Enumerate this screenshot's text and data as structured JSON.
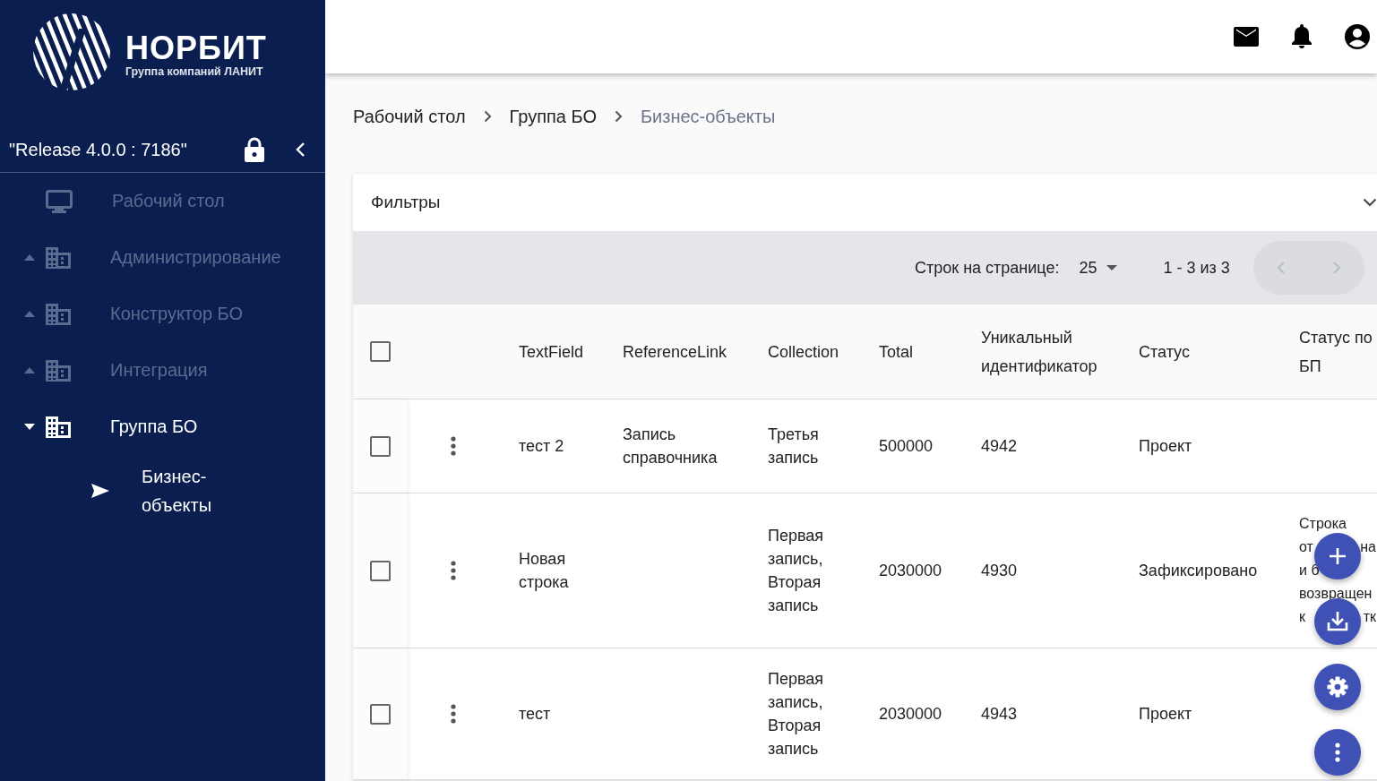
{
  "brand": {
    "name": "НОРБИТ",
    "tagline": "Группа компаний ЛАНИТ"
  },
  "release": "\"Release 4.0.0 : 7186\"",
  "sidebar": {
    "items": [
      {
        "label": "Рабочий стол",
        "kind": "link",
        "selected": false
      },
      {
        "label": "Администрирование",
        "kind": "group",
        "expanded": false,
        "selected": false
      },
      {
        "label": "Конструктор БО",
        "kind": "group",
        "expanded": false,
        "selected": false
      },
      {
        "label": "Интеграция",
        "kind": "group",
        "expanded": false,
        "selected": false
      },
      {
        "label": "Группа БО",
        "kind": "group",
        "expanded": true,
        "selected": true,
        "children": [
          {
            "label": "Бизнес-объекты",
            "selected": true
          }
        ]
      }
    ]
  },
  "breadcrumbs": [
    "Рабочий стол",
    "Группа БО",
    "Бизнес-объекты"
  ],
  "filters": {
    "title": "Фильтры",
    "expanded": false
  },
  "pagination": {
    "rows_label": "Строк на странице:",
    "rows_per_page": "25",
    "range": "1 - 3 из 3",
    "prev_disabled": true,
    "next_disabled": true
  },
  "table": {
    "columns": [
      "TextField",
      "ReferenceLink",
      "Collection",
      "Total",
      "Уникальный идентификатор",
      "Статус",
      "Статус по БП"
    ],
    "all_checked": false,
    "rows": [
      {
        "checked": false,
        "cells": [
          "тест 2",
          "Запись справочника",
          "Третья запись",
          "500000",
          "4942",
          "Проект",
          ""
        ]
      },
      {
        "checked": false,
        "cells": [
          "Новая строка",
          "",
          "Первая запись, Вторая запись",
          "2030000",
          "4930",
          "Зафиксировано",
          [
            [
              "Строка"
            ],
            [
              "от",
              "на"
            ],
            [
              "и б"
            ],
            [
              "возвращен"
            ],
            [
              "к",
              "тк"
            ]
          ]
        ]
      },
      {
        "checked": false,
        "cells": [
          "тест",
          "",
          "Первая запись, Вторая запись",
          "2030000",
          "4943",
          "Проект",
          ""
        ]
      }
    ]
  }
}
